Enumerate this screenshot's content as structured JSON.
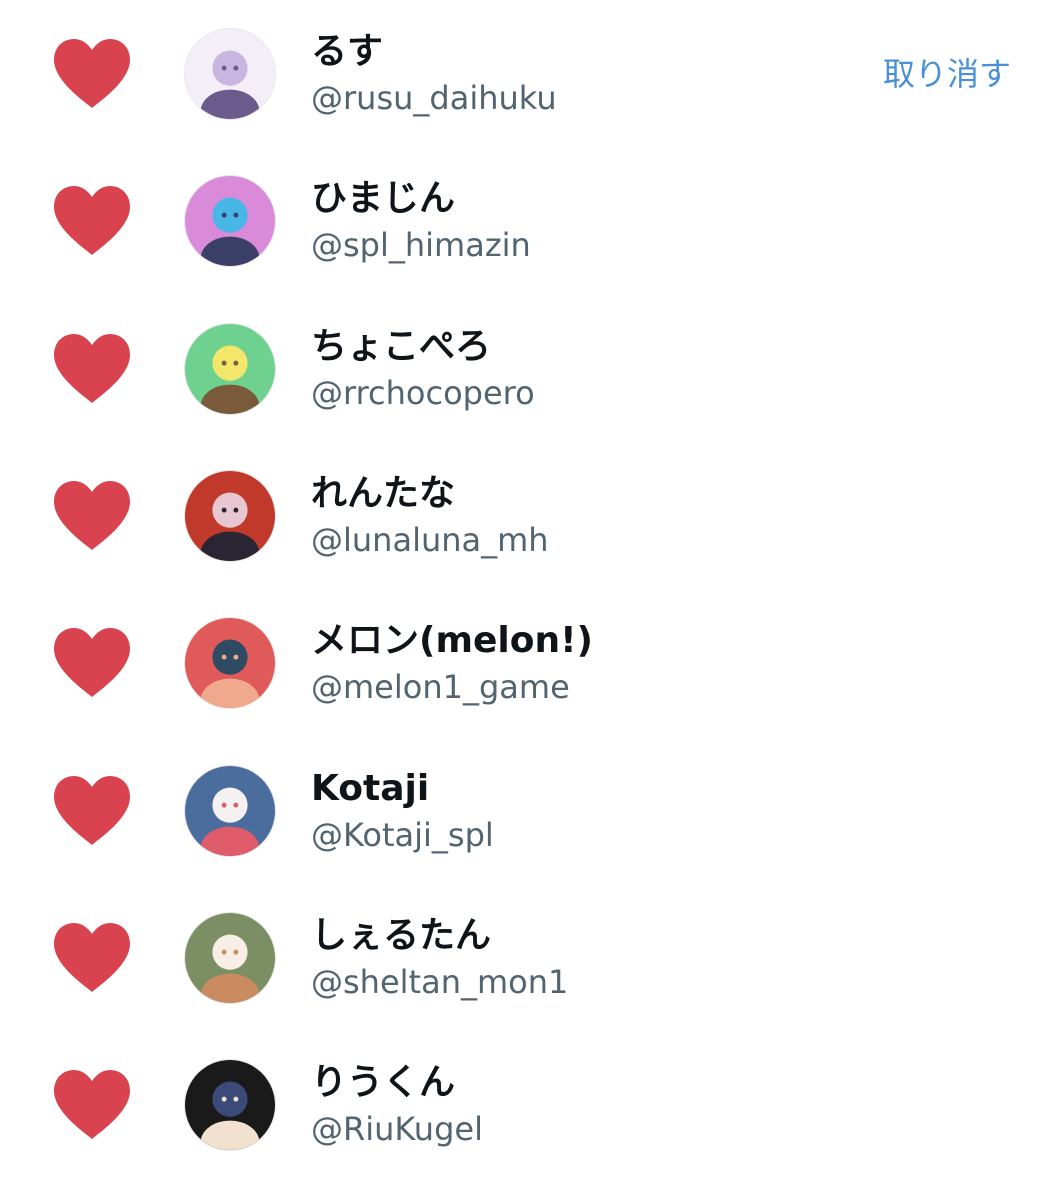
{
  "accent_color": "#4a90d9",
  "heart_color": "#d9434f",
  "liked_users": [
    {
      "name": "るす",
      "handle": "@rusu_daihuku",
      "action": "取り消す",
      "avatar": "avatar-illustration",
      "colors": [
        "#c9b6e0",
        "#6b5a8c",
        "#f3eef8"
      ]
    },
    {
      "name": "ひまじん",
      "handle": "@spl_himazin",
      "avatar": "avatar-illustration",
      "colors": [
        "#48b7e8",
        "#3a3f66",
        "#d98ad9"
      ]
    },
    {
      "name": "ちょこぺろ",
      "handle": "@rrchocopero",
      "avatar": "avatar-illustration",
      "colors": [
        "#f2e66b",
        "#7a5a3a",
        "#6fd18f"
      ]
    },
    {
      "name": "れんたな",
      "handle": "@lunaluna_mh",
      "avatar": "avatar-illustration",
      "colors": [
        "#e8c8d0",
        "#2b2433",
        "#c0392b"
      ]
    },
    {
      "name": "メロン(melon!)",
      "handle": "@melon1_game",
      "avatar": "avatar-photo",
      "colors": [
        "#2f4a63",
        "#f0a98c",
        "#e05a5a"
      ]
    },
    {
      "name": "Kotaji",
      "handle": "@Kotaji_spl",
      "avatar": "avatar-illustration",
      "colors": [
        "#f4f1f0",
        "#e15c6a",
        "#4b6d9e"
      ]
    },
    {
      "name": "しぇるたん",
      "handle": "@sheltan_mon1",
      "avatar": "avatar-illustration",
      "colors": [
        "#f7efe6",
        "#c98b5f",
        "#7c8f64"
      ]
    },
    {
      "name": "りうくん",
      "handle": "@RiuKugel",
      "avatar": "avatar-illustration",
      "colors": [
        "#3c4a7a",
        "#f3e1cf",
        "#1a1a1a"
      ]
    }
  ]
}
